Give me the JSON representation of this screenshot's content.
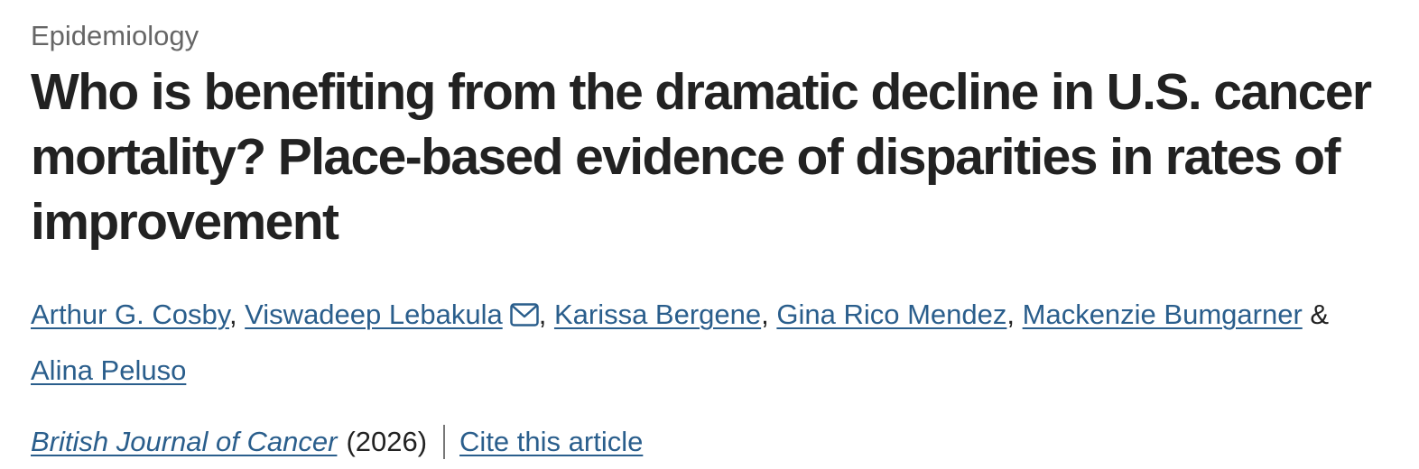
{
  "article": {
    "subject": "Epidemiology",
    "title": "Who is benefiting from the dramatic decline in U.S. cancer mortality? Place-based evidence of disparities in rates of improvement",
    "authors": [
      {
        "name": "Arthur G. Cosby",
        "separator": ", "
      },
      {
        "name": "Viswadeep Lebakula",
        "separator": ", "
      },
      {
        "name": "Karissa Bergene",
        "separator": ", "
      },
      {
        "name": "Gina Rico Mendez",
        "separator": ", "
      },
      {
        "name": "Mackenzie Bumgarner",
        "separator": " & "
      },
      {
        "name": "Alina Peluso",
        "separator": ""
      }
    ],
    "corresponding_icon": "mail-icon",
    "journal": "British Journal of Cancer",
    "year": "(2026)",
    "cite_label": "Cite this article",
    "link_color": "#2a5e8c"
  }
}
